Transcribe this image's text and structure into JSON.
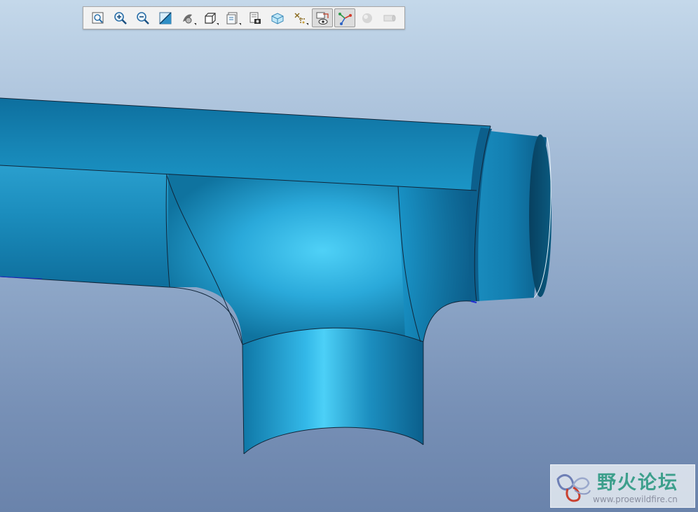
{
  "toolbar": {
    "buttons": [
      {
        "icon": "refit-icon",
        "active": false,
        "dropdown": false
      },
      {
        "icon": "zoom-in-icon",
        "active": false,
        "dropdown": false
      },
      {
        "icon": "zoom-out-icon",
        "active": false,
        "dropdown": false
      },
      {
        "icon": "repaint-icon",
        "active": false,
        "dropdown": false
      },
      {
        "icon": "display-style-icon",
        "active": false,
        "dropdown": true
      },
      {
        "icon": "saved-orientations-icon",
        "active": false,
        "dropdown": true
      },
      {
        "icon": "view-manager-icon",
        "active": false,
        "dropdown": true
      },
      {
        "icon": "snapshot-icon",
        "active": false,
        "dropdown": false
      },
      {
        "icon": "perspective-icon",
        "active": false,
        "dropdown": false
      },
      {
        "icon": "datum-display-icon",
        "active": false,
        "dropdown": true
      },
      {
        "icon": "annotation-display-icon",
        "active": true,
        "dropdown": false
      },
      {
        "icon": "spin-center-icon",
        "active": true,
        "dropdown": false
      },
      {
        "icon": "appearance-icon",
        "active": false,
        "dropdown": false
      },
      {
        "icon": "section-icon",
        "active": false,
        "dropdown": false
      }
    ]
  },
  "colors": {
    "model_mid": "#1c8fc0",
    "model_light": "#49cbf3",
    "model_dark": "#0b5c86",
    "edge": "#10263a",
    "watermark_text": "#3d9f8c"
  },
  "watermark": {
    "title": "野火论坛",
    "url": "www.proewildfire.cn"
  }
}
